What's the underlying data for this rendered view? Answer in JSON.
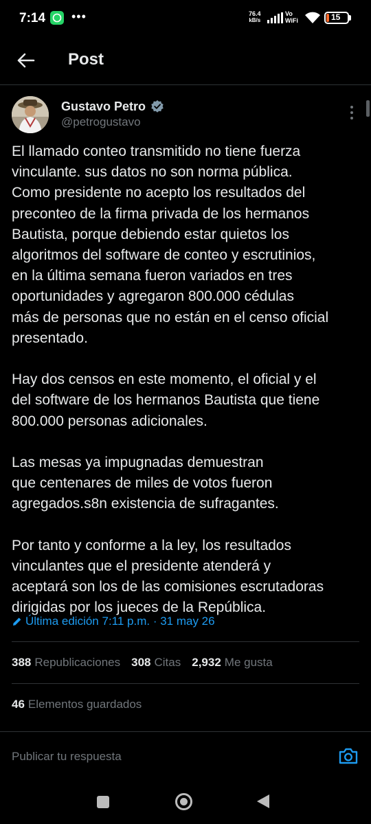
{
  "status_bar": {
    "time": "7:14",
    "notification_more": "•••",
    "net_speed_value": "76.4",
    "net_speed_unit": "kB/s",
    "vowifi_top": "Vo",
    "vowifi_bottom": "WiFi",
    "battery_level": "15",
    "icons": [
      "whatsapp-icon",
      "signal-icon",
      "wifi-icon",
      "battery-icon"
    ]
  },
  "header": {
    "title": "Post",
    "back_icon": "back-arrow-icon"
  },
  "author": {
    "name": "Gustavo Petro",
    "handle": "@petrogustavo",
    "verified_icon": "verified-badge-icon",
    "more_icon": "more-vertical-icon"
  },
  "post": {
    "paragraphs": [
      "El llamado conteo transmitido no tiene fuerza\nvinculante. sus datos no son norma pública.\nComo presidente no acepto los resultados del\npreconteo de la firma privada  de los hermanos\nBautista, porque debiendo estar quietos los\nalgoritmos del software de conteo y escrutinios,\nen la última semana fueron variados en tres\noportunidades y agregaron 800.000 cédulas\nmás de personas que no están en el censo oficial\npresentado.",
      "Hay dos censos en este momento, el oficial y el\ndel software de los hermanos Bautista que tiene\n800.000 personas adicionales.",
      "Las mesas ya impugnadas demuestran\nque centenares de miles de votos fueron\nagregados.s8n existencia de sufragantes.",
      "Por tanto y conforme a la ley, los resultados\nvinculantes que el presidente atenderá y\naceptará son los de las comisiones escrutadoras\ndirigidas por los jueces de la República."
    ],
    "edit_label": "Última edición 7:11 p.m. · 31 may 26",
    "edit_icon": "pencil-icon"
  },
  "stats": {
    "reposts_count": "388",
    "reposts_label": "Republicaciones",
    "quotes_count": "308",
    "quotes_label": "Citas",
    "likes_count": "2,932",
    "likes_label": "Me gusta",
    "saves_count": "46",
    "saves_label": "Elementos guardados"
  },
  "reply": {
    "placeholder": "Publicar tu respuesta",
    "camera_icon": "camera-icon"
  },
  "colors": {
    "background": "#000000",
    "text": "#e7e9ea",
    "secondary_text": "#71767b",
    "accent": "#1d9bf0",
    "divider": "#2f3336"
  },
  "nav_bar": {
    "icons": [
      "recents-square-icon",
      "home-circle-icon",
      "back-triangle-icon"
    ]
  }
}
